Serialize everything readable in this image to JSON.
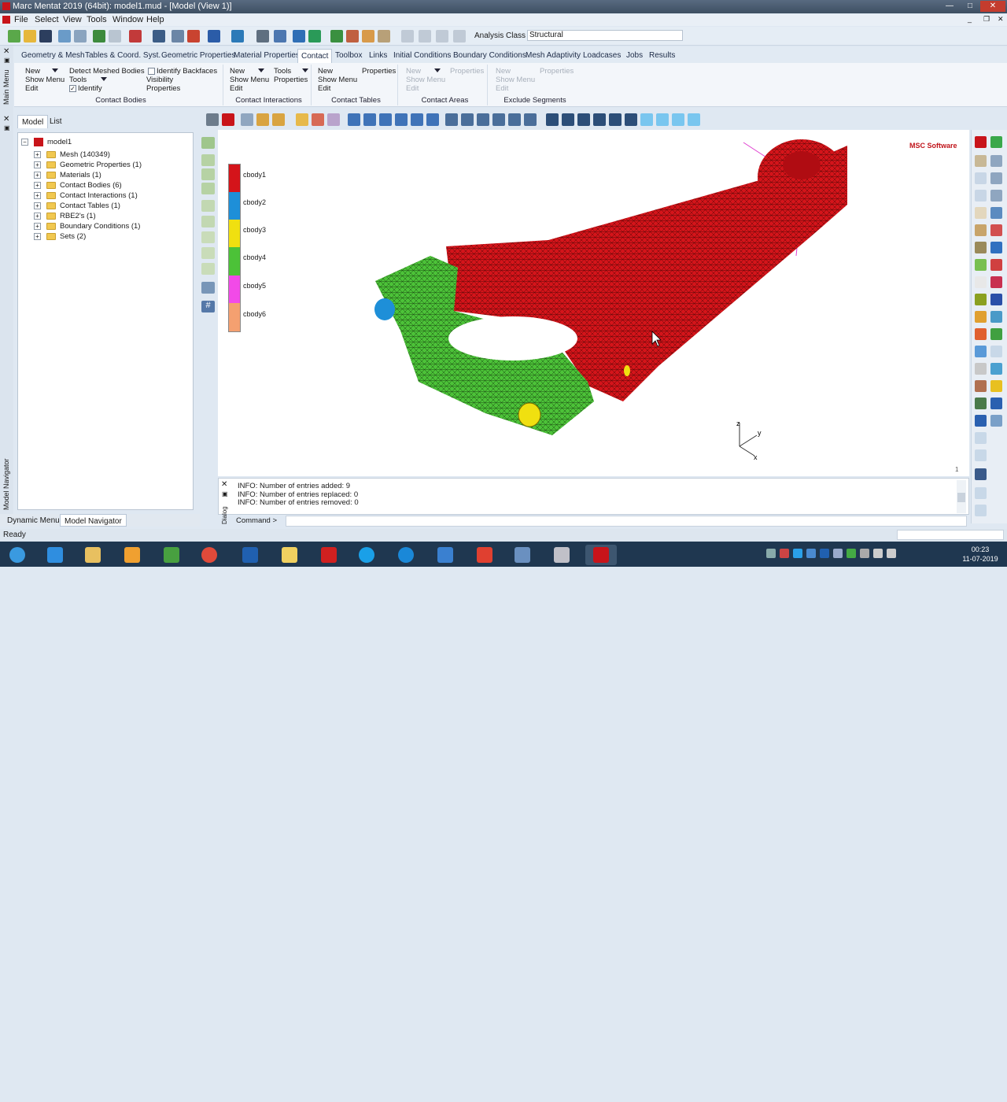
{
  "window": {
    "title": "Marc Mentat 2019 (64bit): model1.mud - [Model (View 1)]",
    "min": "—",
    "max": "□",
    "close": "✕"
  },
  "menu": [
    "File",
    "Select",
    "View",
    "Tools",
    "Window",
    "Help"
  ],
  "analysis": {
    "label": "Analysis Class",
    "value": "Structural"
  },
  "tabs": [
    "Geometry & Mesh",
    "Tables & Coord. Syst.",
    "Geometric Properties",
    "Material Properties",
    "Contact",
    "Toolbox",
    "Links",
    "Initial Conditions",
    "Boundary Conditions",
    "Mesh Adaptivity",
    "Loadcases",
    "Jobs",
    "Results"
  ],
  "ribbon": {
    "bodies": {
      "new": "New",
      "show": "Show Menu",
      "edit": "Edit",
      "detect": "Detect Meshed Bodies",
      "tools": "Tools",
      "identify": "Identify",
      "backfaces": "Identify Backfaces",
      "visibility": "Visibility",
      "properties": "Properties",
      "label": "Contact Bodies"
    },
    "interactions": {
      "new": "New",
      "show": "Show Menu",
      "edit": "Edit",
      "tools": "Tools",
      "properties": "Properties",
      "label": "Contact Interactions"
    },
    "tables": {
      "new": "New",
      "show": "Show Menu",
      "edit": "Edit",
      "properties": "Properties",
      "label": "Contact Tables"
    },
    "areas": {
      "new": "New",
      "show": "Show Menu",
      "edit": "Edit",
      "properties": "Properties",
      "label": "Contact Areas"
    },
    "segments": {
      "new": "New",
      "show": "Show Menu",
      "edit": "Edit",
      "properties": "Properties",
      "label": "Exclude Segments"
    }
  },
  "left_strip": {
    "main": "Main Menu",
    "navigator": "Model Navigator"
  },
  "panel_tabs": [
    "Model",
    "List"
  ],
  "tree": {
    "root": "model1",
    "items": [
      "Mesh (140349)",
      "Geometric Properties (1)",
      "Materials (1)",
      "Contact Bodies (6)",
      "Contact Interactions (1)",
      "Contact Tables (1)",
      "RBE2's (1)",
      "Boundary Conditions (1)",
      "Sets (2)"
    ]
  },
  "legend": [
    {
      "label": "cbody1",
      "color": "#d4141a"
    },
    {
      "label": "cbody2",
      "color": "#1e8fd8"
    },
    {
      "label": "cbody3",
      "color": "#f0e010"
    },
    {
      "label": "cbody4",
      "color": "#4cc238"
    },
    {
      "label": "cbody5",
      "color": "#f24ae8"
    },
    {
      "label": "cbody6",
      "color": "#f4a070"
    }
  ],
  "logo": "MSC Software",
  "axes": {
    "z": "z",
    "y": "y",
    "x": "x"
  },
  "viewport_num": "1",
  "dialog": {
    "tab": "Dialog",
    "lines": [
      "INFO: Number of entries added: 9",
      "INFO: Number of entries replaced: 0",
      "INFO: Number of entries removed: 0"
    ]
  },
  "command": "Command >",
  "bottom_tabs": [
    "Dynamic Menu",
    "Model Navigator"
  ],
  "status": "Ready",
  "clock": {
    "time": "00:23",
    "date": "11-07-2019"
  }
}
